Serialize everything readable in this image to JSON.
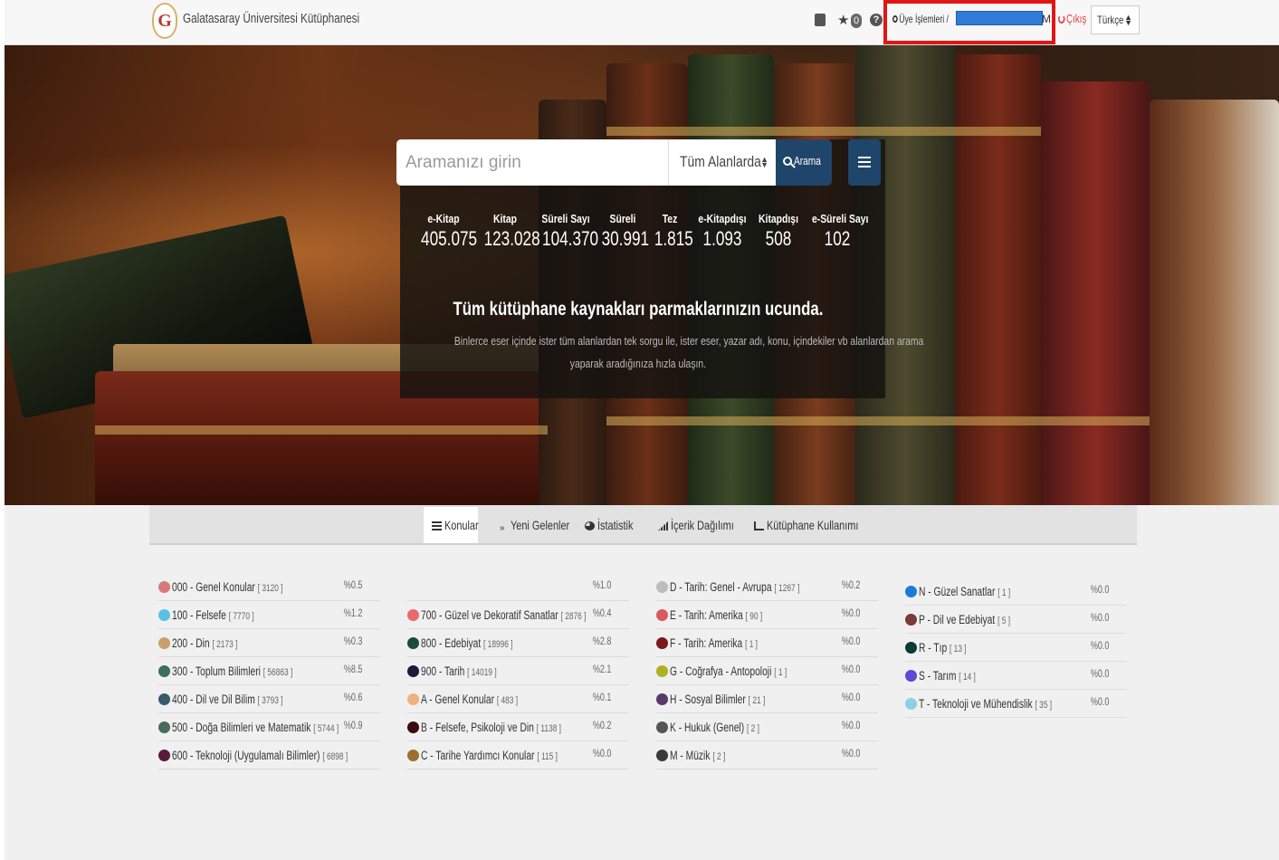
{
  "header": {
    "site_title": "Galatasaray Üniversitesi Kütüphanesi",
    "logo_letter": "G",
    "favorites_count": "0",
    "help_glyph": "?",
    "member_label": "Üye İşlemleri /",
    "member_tail": "M",
    "logout_label": "Çıkış",
    "language": "Türkçe"
  },
  "search": {
    "placeholder": "Aramanızı girin",
    "scope": "Tüm Alanlarda",
    "button_label": "Arama"
  },
  "stats": [
    {
      "label": "e-Kitap",
      "value": "405.075"
    },
    {
      "label": "Kitap",
      "value": "123.028"
    },
    {
      "label": "Süreli Sayı",
      "value": "104.370"
    },
    {
      "label": "Süreli",
      "value": "30.991"
    },
    {
      "label": "Tez",
      "value": "1.815"
    },
    {
      "label": "e-Kitapdışı",
      "value": "1.093"
    },
    {
      "label": "Kitapdışı",
      "value": "508"
    },
    {
      "label": "e-Süreli Sayı",
      "value": "102"
    }
  ],
  "hero": {
    "tagline": "Tüm kütüphane kaynakları parmaklarınızın ucunda.",
    "description_1": "Binlerce eser içinde ister tüm alanlardan tek sorgu ile, ister eser, yazar adı, konu, içindekiler vb alanlardan arama",
    "description_2": "yaparak aradığınıza hızla ulaşın."
  },
  "tabs": [
    {
      "label": "Konular",
      "icon": "list-icon"
    },
    {
      "label": "Yeni Gelenler",
      "icon": "chevron-down-double-icon"
    },
    {
      "label": "İstatistik",
      "icon": "pie-chart-icon"
    },
    {
      "label": "İçerik Dağılımı",
      "icon": "signal-bars-icon"
    },
    {
      "label": "Kütüphane Kullanımı",
      "icon": "area-chart-icon"
    }
  ],
  "subjects": {
    "col1": [
      {
        "name": "000 - Genel Konular",
        "count": "[ 3120 ]",
        "pct": "%0.5",
        "color": "#d97a7a"
      },
      {
        "name": "100 - Felsefe",
        "count": "[ 7770 ]",
        "pct": "%1.2",
        "color": "#5bc0e8"
      },
      {
        "name": "200 - Din",
        "count": "[ 2173 ]",
        "pct": "%0.3",
        "color": "#c9a06a"
      },
      {
        "name": "300 - Toplum Bilimleri",
        "count": "[ 56863 ]",
        "pct": "%8.5",
        "color": "#3e6f5a"
      },
      {
        "name": "400 - Dil ve Dil Bilim",
        "count": "[ 3793 ]",
        "pct": "%0.6",
        "color": "#3a5a6a"
      },
      {
        "name": "500 - Doğa Bilimleri ve Matematik",
        "count": "[ 5744 ]",
        "pct": "%0.9",
        "color": "#4a6a5a"
      },
      {
        "name": "600 - Teknoloji (Uygulamalı Bilimler)",
        "count": "[ 6898 ]",
        "pct": "",
        "color": "#5a1a3a"
      }
    ],
    "col2": [
      {
        "name": "",
        "count": "",
        "pct": "%1.0",
        "color": ""
      },
      {
        "name": "700 - Güzel ve Dekoratif Sanatlar",
        "count": "[ 2876 ]",
        "pct": "%0.4",
        "color": "#e86a6a"
      },
      {
        "name": "800 - Edebiyat",
        "count": "[ 18996 ]",
        "pct": "%2.8",
        "color": "#1f4a3a"
      },
      {
        "name": "900 - Tarih",
        "count": "[ 14019 ]",
        "pct": "%2.1",
        "color": "#1a1a3a"
      },
      {
        "name": "A - Genel Konular",
        "count": "[ 483 ]",
        "pct": "%0.1",
        "color": "#f0b080"
      },
      {
        "name": "B - Felsefe, Psikoloji ve Din",
        "count": "[ 1138 ]",
        "pct": "%0.2",
        "color": "#3a0a10"
      },
      {
        "name": "C - Tarihe Yardımcı Konular",
        "count": "[ 115 ]",
        "pct": "%0.0",
        "color": "#9a7030"
      }
    ],
    "col3": [
      {
        "name": "D - Tarih: Genel - Avrupa",
        "count": "[ 1267 ]",
        "pct": "%0.2",
        "color": "#bdbdbd"
      },
      {
        "name": "E - Tarih: Amerika",
        "count": "[ 90 ]",
        "pct": "%0.0",
        "color": "#d85a5a"
      },
      {
        "name": "F - Tarih: Amerika",
        "count": "[ 1 ]",
        "pct": "%0.0",
        "color": "#7a1a1a"
      },
      {
        "name": "G - Coğrafya - Antopoloji",
        "count": "[ 1 ]",
        "pct": "%0.0",
        "color": "#b0b020"
      },
      {
        "name": "H - Sosyal Bilimler",
        "count": "[ 21 ]",
        "pct": "%0.0",
        "color": "#5a3a6a"
      },
      {
        "name": "K - Hukuk (Genel)",
        "count": "[ 2 ]",
        "pct": "%0.0",
        "color": "#555555"
      },
      {
        "name": "M - Müzik",
        "count": "[ 2 ]",
        "pct": "%0.0",
        "color": "#3a3a3a"
      }
    ],
    "col4": [
      {
        "name": "N - Güzel Sanatlar",
        "count": "[ 1 ]",
        "pct": "%0.0",
        "color": "#1a7ad8"
      },
      {
        "name": "P - Dil ve Edebiyat",
        "count": "[ 5 ]",
        "pct": "%0.0",
        "color": "#7a3a3a"
      },
      {
        "name": "R - Tıp",
        "count": "[ 13 ]",
        "pct": "%0.0",
        "color": "#0a3a3a"
      },
      {
        "name": "S - Tarım",
        "count": "[ 14 ]",
        "pct": "%0.0",
        "color": "#5a4ad8"
      },
      {
        "name": "T - Teknoloji ve Mühendislik",
        "count": "[ 35 ]",
        "pct": "%0.0",
        "color": "#8ad0e8"
      }
    ]
  }
}
